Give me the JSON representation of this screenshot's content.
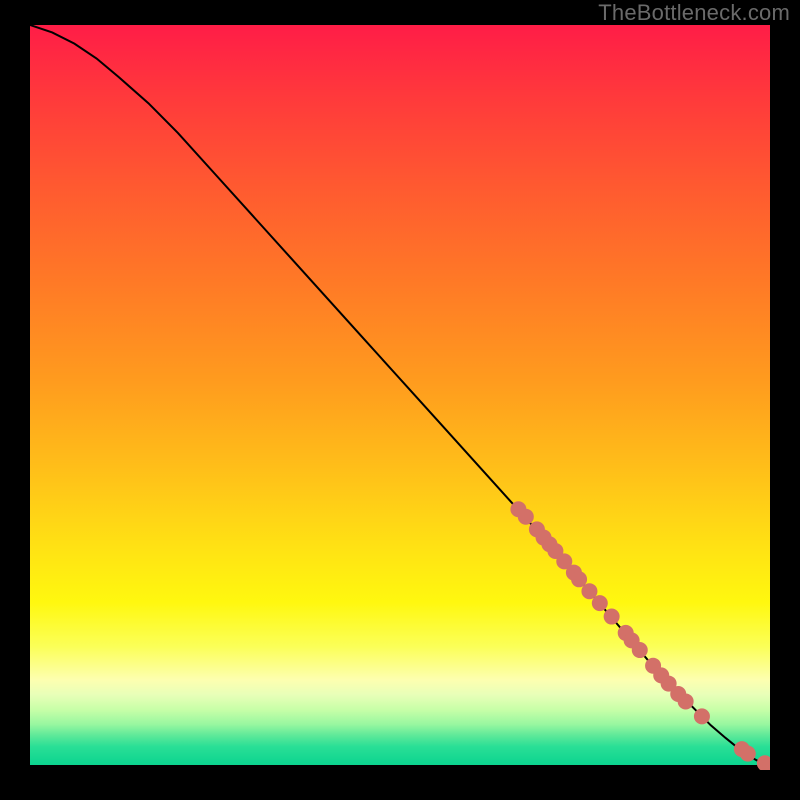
{
  "watermark": "TheBottleneck.com",
  "colors": {
    "marker": "#d37068",
    "curve": "#000000",
    "bg": "#000000"
  },
  "gradient_stops": [
    {
      "offset": 0.0,
      "color": "#ff1d47"
    },
    {
      "offset": 0.1,
      "color": "#ff3a3b"
    },
    {
      "offset": 0.22,
      "color": "#ff5a30"
    },
    {
      "offset": 0.35,
      "color": "#ff7a26"
    },
    {
      "offset": 0.48,
      "color": "#ff9b1e"
    },
    {
      "offset": 0.6,
      "color": "#ffbf19"
    },
    {
      "offset": 0.7,
      "color": "#ffe014"
    },
    {
      "offset": 0.78,
      "color": "#fff80f"
    },
    {
      "offset": 0.84,
      "color": "#fbff58"
    },
    {
      "offset": 0.885,
      "color": "#fdffb0"
    },
    {
      "offset": 0.905,
      "color": "#e8ffb8"
    },
    {
      "offset": 0.925,
      "color": "#c8ffa8"
    },
    {
      "offset": 0.945,
      "color": "#98f7a0"
    },
    {
      "offset": 0.96,
      "color": "#5ee999"
    },
    {
      "offset": 0.975,
      "color": "#2adf96"
    },
    {
      "offset": 1.0,
      "color": "#0bd48f"
    }
  ],
  "chart_data": {
    "type": "line",
    "title": "",
    "xlabel": "",
    "ylabel": "",
    "xlim": [
      0,
      100
    ],
    "ylim": [
      0,
      100
    ],
    "grid": false,
    "series": [
      {
        "name": "bottleneck-curve",
        "x": [
          0,
          3,
          6,
          9,
          12,
          16,
          20,
          25,
          30,
          35,
          40,
          45,
          50,
          55,
          60,
          65,
          70,
          73,
          76,
          79,
          82,
          85,
          88,
          90,
          92,
          94,
          95.5,
          97,
          98,
          99,
          100
        ],
        "y": [
          100,
          99,
          97.5,
          95.5,
          93,
          89.5,
          85.5,
          80,
          74.5,
          69,
          63.5,
          58,
          52.5,
          47,
          41.5,
          36,
          30.5,
          27,
          23.5,
          20,
          16.5,
          13,
          10,
          8,
          6,
          4.3,
          3.1,
          2.1,
          1.4,
          0.9,
          0.6
        ]
      }
    ],
    "markers": {
      "name": "highlighted-points",
      "points": [
        {
          "x": 66,
          "y": 35.0
        },
        {
          "x": 67,
          "y": 34.0
        },
        {
          "x": 68.5,
          "y": 32.3
        },
        {
          "x": 69.4,
          "y": 31.2
        },
        {
          "x": 70.2,
          "y": 30.3
        },
        {
          "x": 71,
          "y": 29.4
        },
        {
          "x": 72.2,
          "y": 28.0
        },
        {
          "x": 73.5,
          "y": 26.5
        },
        {
          "x": 74.2,
          "y": 25.6
        },
        {
          "x": 75.6,
          "y": 24.0
        },
        {
          "x": 77.0,
          "y": 22.4
        },
        {
          "x": 78.6,
          "y": 20.6
        },
        {
          "x": 80.5,
          "y": 18.4
        },
        {
          "x": 81.3,
          "y": 17.4
        },
        {
          "x": 82.4,
          "y": 16.1
        },
        {
          "x": 84.2,
          "y": 14.0
        },
        {
          "x": 85.3,
          "y": 12.7
        },
        {
          "x": 86.3,
          "y": 11.6
        },
        {
          "x": 87.6,
          "y": 10.2
        },
        {
          "x": 88.6,
          "y": 9.2
        },
        {
          "x": 90.8,
          "y": 7.2
        },
        {
          "x": 96.2,
          "y": 2.8
        },
        {
          "x": 97.0,
          "y": 2.2
        },
        {
          "x": 99.3,
          "y": 0.9
        },
        {
          "x": 100.0,
          "y": 0.6
        }
      ]
    }
  }
}
